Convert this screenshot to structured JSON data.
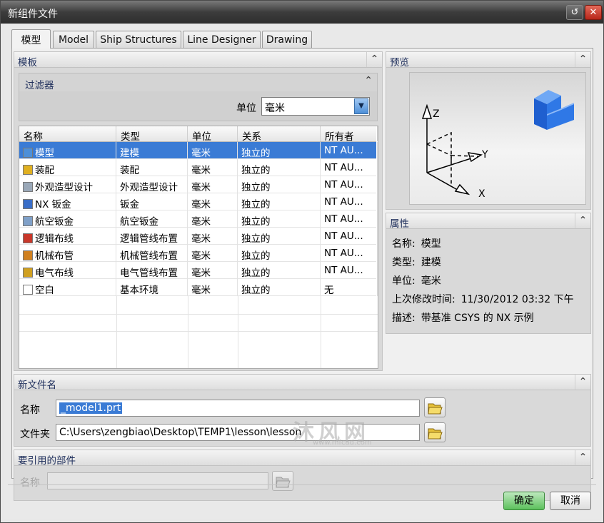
{
  "window": {
    "title": "新组件文件"
  },
  "tabs": [
    "模型",
    "Model",
    "Ship Structures",
    "Line Designer",
    "Drawing"
  ],
  "templates": {
    "label": "模板",
    "filter": {
      "label": "过滤器",
      "unit_label": "单位",
      "unit_value": "毫米"
    },
    "columns": [
      "名称",
      "类型",
      "单位",
      "关系",
      "所有者"
    ],
    "rows": [
      {
        "name": "模型",
        "type": "建模",
        "unit": "毫米",
        "relation": "独立的",
        "owner": "NT AU..."
      },
      {
        "name": "装配",
        "type": "装配",
        "unit": "毫米",
        "relation": "独立的",
        "owner": "NT AU..."
      },
      {
        "name": "外观造型设计",
        "type": "外观造型设计",
        "unit": "毫米",
        "relation": "独立的",
        "owner": "NT AU..."
      },
      {
        "name": "NX 钣金",
        "type": "钣金",
        "unit": "毫米",
        "relation": "独立的",
        "owner": "NT AU..."
      },
      {
        "name": "航空钣金",
        "type": "航空钣金",
        "unit": "毫米",
        "relation": "独立的",
        "owner": "NT AU..."
      },
      {
        "name": "逻辑布线",
        "type": "逻辑管线布置",
        "unit": "毫米",
        "relation": "独立的",
        "owner": "NT AU..."
      },
      {
        "name": "机械布管",
        "type": "机械管线布置",
        "unit": "毫米",
        "relation": "独立的",
        "owner": "NT AU..."
      },
      {
        "name": "电气布线",
        "type": "电气管线布置",
        "unit": "毫米",
        "relation": "独立的",
        "owner": "NT AU..."
      },
      {
        "name": "空白",
        "type": "基本环境",
        "unit": "毫米",
        "relation": "独立的",
        "owner": "无"
      }
    ],
    "selected_row": 0
  },
  "preview": {
    "label": "预览",
    "axis_z": "Z",
    "axis_y": "Y",
    "axis_x": "X"
  },
  "properties": {
    "label": "属性",
    "items": [
      {
        "key": "名称:",
        "value": "模型"
      },
      {
        "key": "类型:",
        "value": "建模"
      },
      {
        "key": "单位:",
        "value": "毫米"
      },
      {
        "key": "上次修改时间:",
        "value": "11/30/2012 03:32 下午"
      },
      {
        "key": "描述:",
        "value": "带基准 CSYS 的 NX 示例"
      }
    ]
  },
  "new_file": {
    "label": "新文件名",
    "name_label": "名称",
    "name_value": "_model1.prt",
    "folder_label": "文件夹",
    "folder_value": "C:\\Users\\zengbiao\\Desktop\\TEMP1\\lesson\\lesson"
  },
  "referenced_part": {
    "label": "要引用的部件",
    "name_label": "名称",
    "name_value": ""
  },
  "buttons": {
    "ok": "确定",
    "cancel": "取消"
  },
  "watermark": {
    "text": "沐风网",
    "url": "www.mfcad.com"
  },
  "colors": {
    "selection": "#3a7bd5",
    "ok_button": "#5cc15c",
    "close_button": "#c8372a",
    "preview_cube": "#1f6fe0"
  }
}
